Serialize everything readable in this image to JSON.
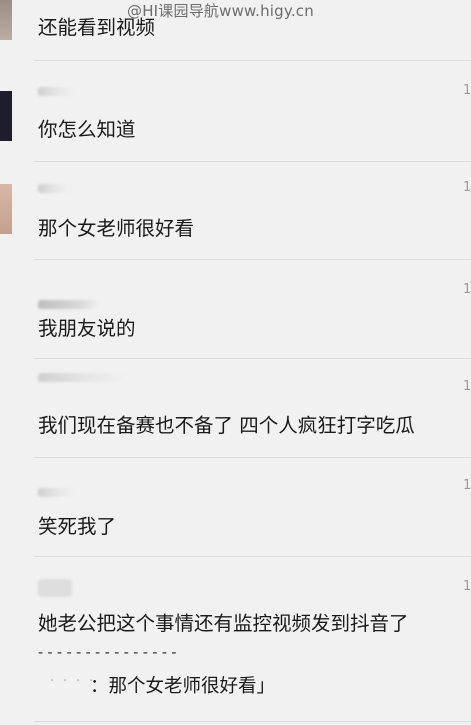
{
  "watermark": "@HI课园导航www.higy.cn",
  "colors": {
    "background": "#f1f1f1",
    "text": "#1a1a1a",
    "divider": "#dcdcdc",
    "timestamp": "#9a9a9a"
  },
  "comments": [
    {
      "text": "还能看到视频",
      "time": ""
    },
    {
      "text": "你怎么知道",
      "time": "1"
    },
    {
      "text": "那个女老师很好看",
      "time": "1"
    },
    {
      "text": "我朋友说的",
      "time": "1"
    },
    {
      "text": "我们现在备赛也不备了 四个人疯狂打字吃瓜",
      "time": "1"
    },
    {
      "text": "笑死我了",
      "time": "1"
    },
    {
      "text": "她老公把这个事情还有监控视频发到抖音了",
      "time": "1",
      "quote_separator": "---------------",
      "quote_text": "：那个女老师很好看」"
    }
  ]
}
